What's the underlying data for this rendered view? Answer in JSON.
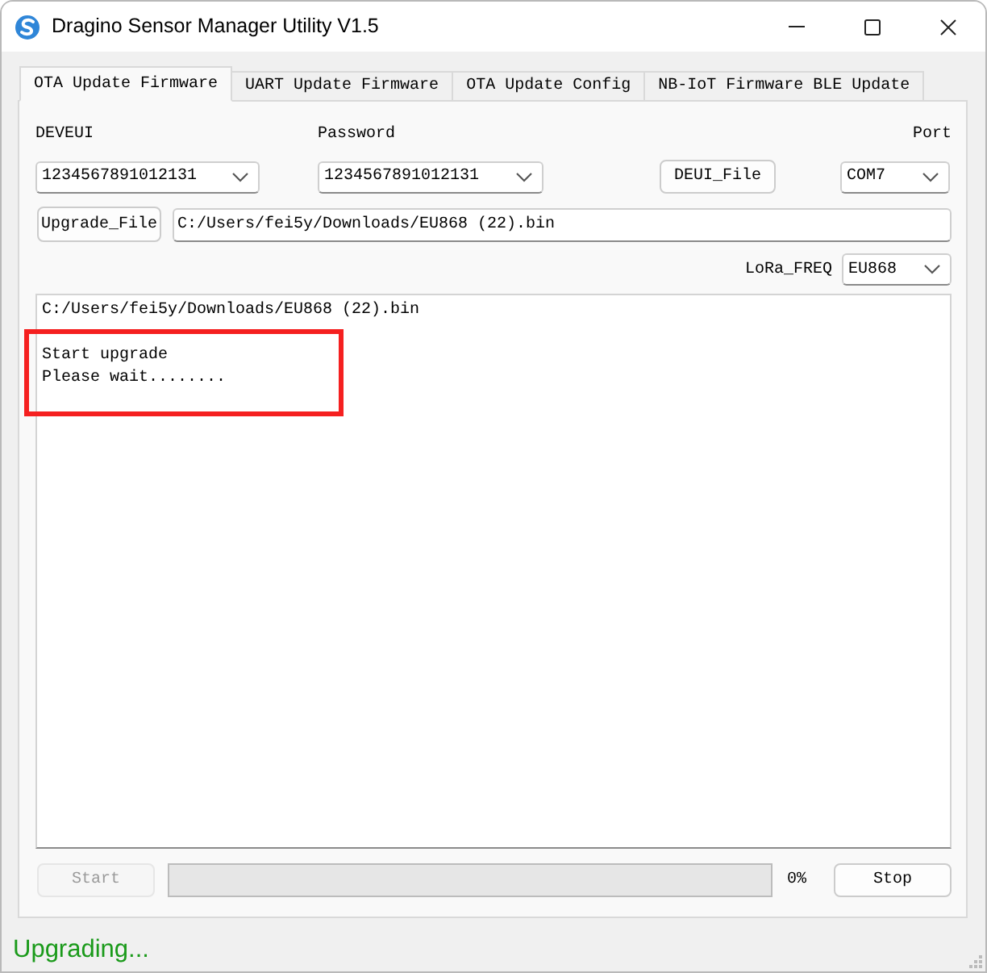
{
  "window": {
    "title": "Dragino Sensor Manager Utility V1.5"
  },
  "tabs": [
    {
      "label": "OTA Update Firmware",
      "selected": true
    },
    {
      "label": "UART Update Firmware",
      "selected": false
    },
    {
      "label": "OTA Update Config",
      "selected": false
    },
    {
      "label": "NB-IoT Firmware BLE Update",
      "selected": false
    }
  ],
  "form": {
    "deveui": {
      "label": "DEVEUI",
      "value": "1234567891012131"
    },
    "password": {
      "label": "Password",
      "value": "1234567891012131"
    },
    "deui_file_button": "DEUI_File",
    "port": {
      "label": "Port",
      "value": "COM7"
    },
    "upgrade_file_button": "Upgrade_File",
    "file_path": "C:/Users/fei5y/Downloads/EU868 (22).bin",
    "lora_freq": {
      "label": "LoRa_FREQ",
      "value": "EU868"
    }
  },
  "log": {
    "blocks": [
      [
        "C:/Users/fei5y/Downloads/EU868 (22).bin"
      ],
      [
        "Start upgrade",
        "Please wait........"
      ]
    ]
  },
  "controls": {
    "start_button": {
      "label": "Start",
      "disabled": true
    },
    "progress": {
      "level": 0,
      "reading": "0%"
    },
    "stop_button": {
      "label": "Stop",
      "disabled": false
    }
  },
  "status_bar": {
    "text": "Upgrading..."
  }
}
